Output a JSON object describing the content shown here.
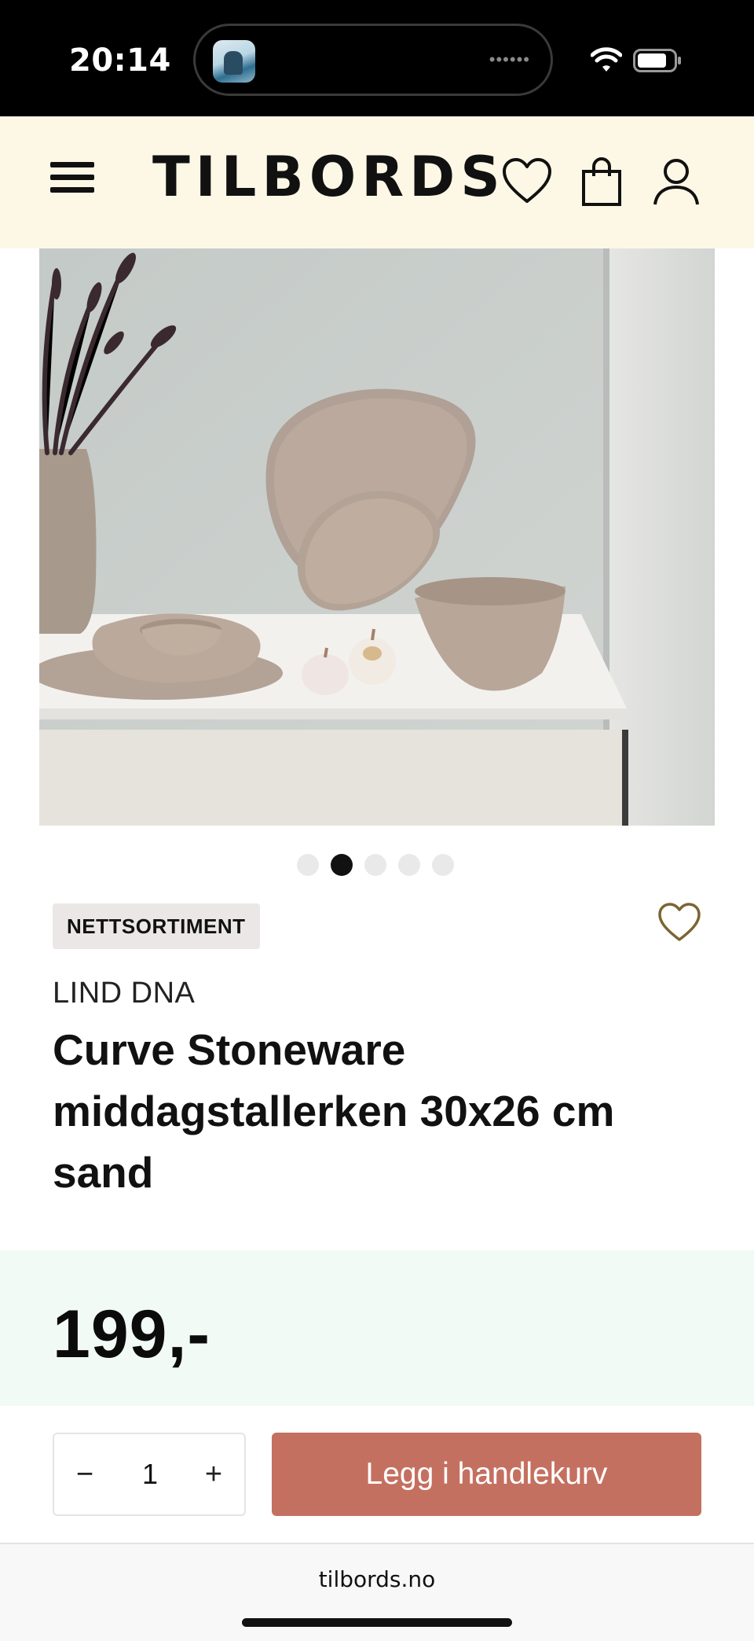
{
  "status_bar": {
    "time": "20:14",
    "island_dots": "••••••"
  },
  "header": {
    "brand": "TILBORDS",
    "icons": [
      "menu-icon",
      "heart-icon",
      "shopping-bag-icon",
      "user-icon"
    ]
  },
  "gallery": {
    "slide_count": 5,
    "active_index": 1
  },
  "product": {
    "badge": "NETTSORTIMENT",
    "brand": "LIND DNA",
    "title": "Curve Stoneware middagstallerken 30x26 cm sand",
    "price": "199,-"
  },
  "purchase": {
    "minus": "−",
    "quantity": "1",
    "plus": "+",
    "add_to_cart": "Legg i handlekurv"
  },
  "browser": {
    "url": "tilbords.no"
  },
  "colors": {
    "header_bg": "#fdf8e6",
    "cta": "#c47060",
    "price_bg": "#f2faf6"
  }
}
